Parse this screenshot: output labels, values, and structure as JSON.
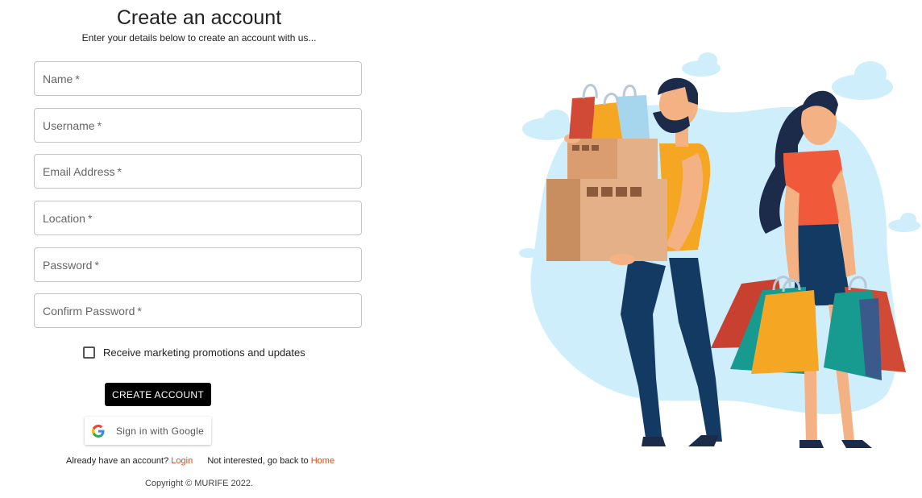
{
  "page": {
    "title": "Create an account",
    "subtitle": "Enter your details below to create an account with us..."
  },
  "form": {
    "fields": [
      {
        "label": "Name",
        "required_mark": "*",
        "value": ""
      },
      {
        "label": "Username",
        "required_mark": "*",
        "value": ""
      },
      {
        "label": "Email Address",
        "required_mark": "*",
        "value": ""
      },
      {
        "label": "Location",
        "required_mark": "*",
        "value": ""
      },
      {
        "label": "Password",
        "required_mark": "*",
        "value": ""
      },
      {
        "label": "Confirm Password",
        "required_mark": "*",
        "value": ""
      }
    ],
    "marketing_checkbox": {
      "label": "Receive marketing promotions and updates",
      "checked": false
    },
    "create_button": "CREATE ACCOUNT",
    "google_button": "Sign in with Google"
  },
  "footer": {
    "have_account_text": "Already have an account?",
    "login_link": "Login",
    "not_interested_text": "Not interested, go back to",
    "home_link": "Home",
    "copyright": "Copyright © MURIFE 2022."
  },
  "colors": {
    "accent_link": "#e04a0e",
    "button_bg": "#000000",
    "illustration_backdrop": "#cdeefa"
  },
  "icons": {
    "google": "google-g-icon",
    "illustration": "shopping-couple-illustration"
  }
}
